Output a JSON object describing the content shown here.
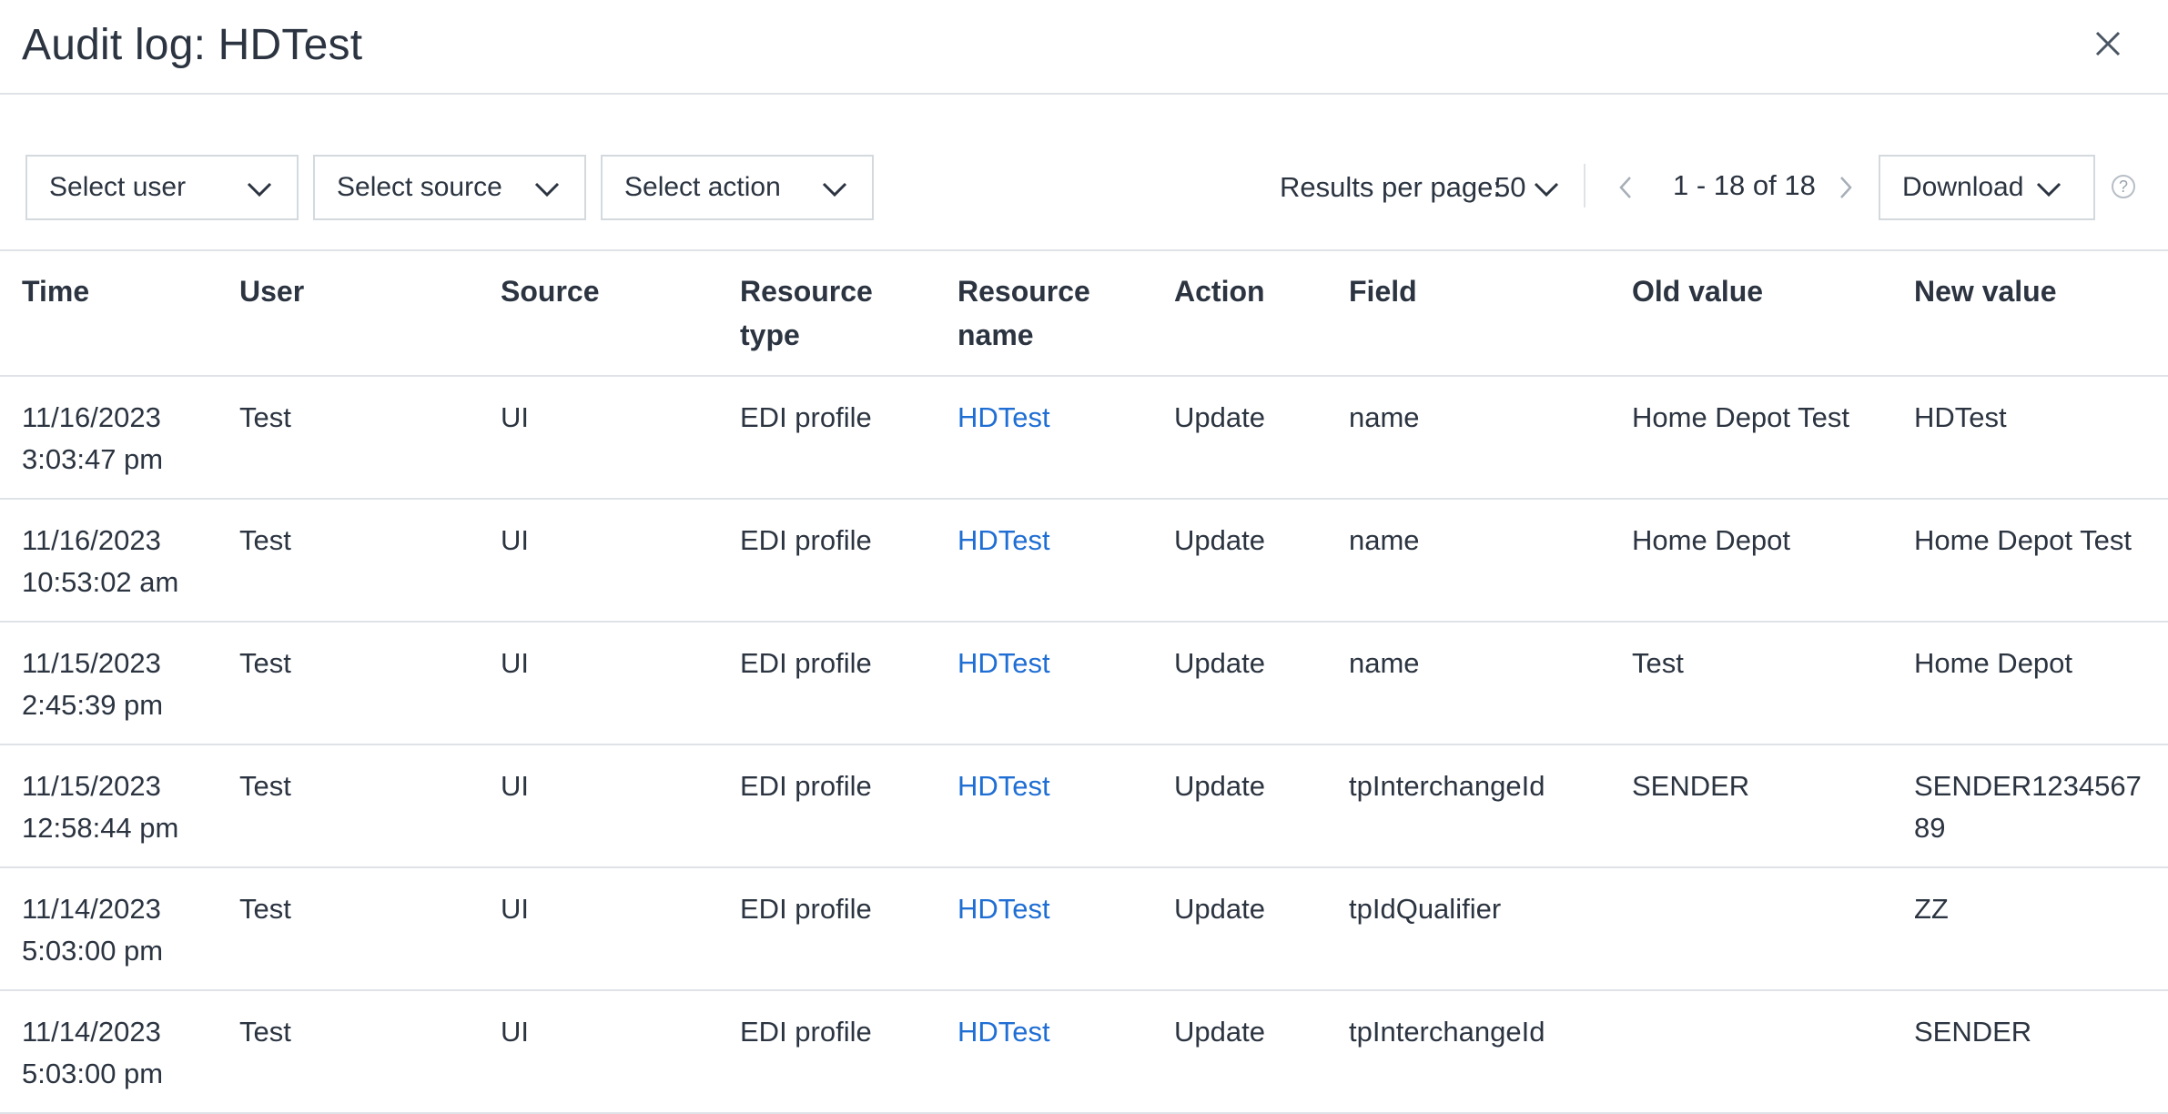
{
  "dialog": {
    "title": "Audit log: HDTest",
    "close_icon": "close-icon"
  },
  "filters": {
    "user": "Select user",
    "source": "Select source",
    "action": "Select action"
  },
  "pagination": {
    "results_per_page_label": "Results per page:",
    "results_per_page_value": "50",
    "range": "1 - 18 of 18"
  },
  "download_label": "Download",
  "help_glyph": "?",
  "columns": [
    "Time",
    "User",
    "Source",
    "Resource type",
    "Resource name",
    "Action",
    "Field",
    "Old value",
    "New value"
  ],
  "rows": [
    {
      "time_date": "11/16/2023",
      "time_clock": "3:03:47 pm",
      "user": "Test",
      "source": "UI",
      "resource_type": "EDI profile",
      "resource_name": "HDTest",
      "action": "Update",
      "field": "name",
      "old_value": "Home Depot Test",
      "new_value": "HDTest"
    },
    {
      "time_date": "11/16/2023",
      "time_clock": "10:53:02 am",
      "user": "Test",
      "source": "UI",
      "resource_type": "EDI profile",
      "resource_name": "HDTest",
      "action": "Update",
      "field": "name",
      "old_value": "Home Depot",
      "new_value": "Home Depot Test"
    },
    {
      "time_date": "11/15/2023",
      "time_clock": "2:45:39 pm",
      "user": "Test",
      "source": "UI",
      "resource_type": "EDI profile",
      "resource_name": "HDTest",
      "action": "Update",
      "field": "name",
      "old_value": "Test",
      "new_value": "Home Depot"
    },
    {
      "time_date": "11/15/2023",
      "time_clock": "12:58:44 pm",
      "user": "Test",
      "source": "UI",
      "resource_type": "EDI profile",
      "resource_name": "HDTest",
      "action": "Update",
      "field": "tpInterchangeId",
      "old_value": "SENDER",
      "new_value": "SENDER123456789"
    },
    {
      "time_date": "11/14/2023",
      "time_clock": "5:03:00 pm",
      "user": "Test",
      "source": "UI",
      "resource_type": "EDI profile",
      "resource_name": "HDTest",
      "action": "Update",
      "field": "tpIdQualifier",
      "old_value": "",
      "new_value": "ZZ"
    },
    {
      "time_date": "11/14/2023",
      "time_clock": "5:03:00 pm",
      "user": "Test",
      "source": "UI",
      "resource_type": "EDI profile",
      "resource_name": "HDTest",
      "action": "Update",
      "field": "tpInterchangeId",
      "old_value": "",
      "new_value": "SENDER"
    }
  ],
  "colors": {
    "text": "#2b3440",
    "link": "#1f6ed4",
    "border": "#dfe3e8"
  }
}
